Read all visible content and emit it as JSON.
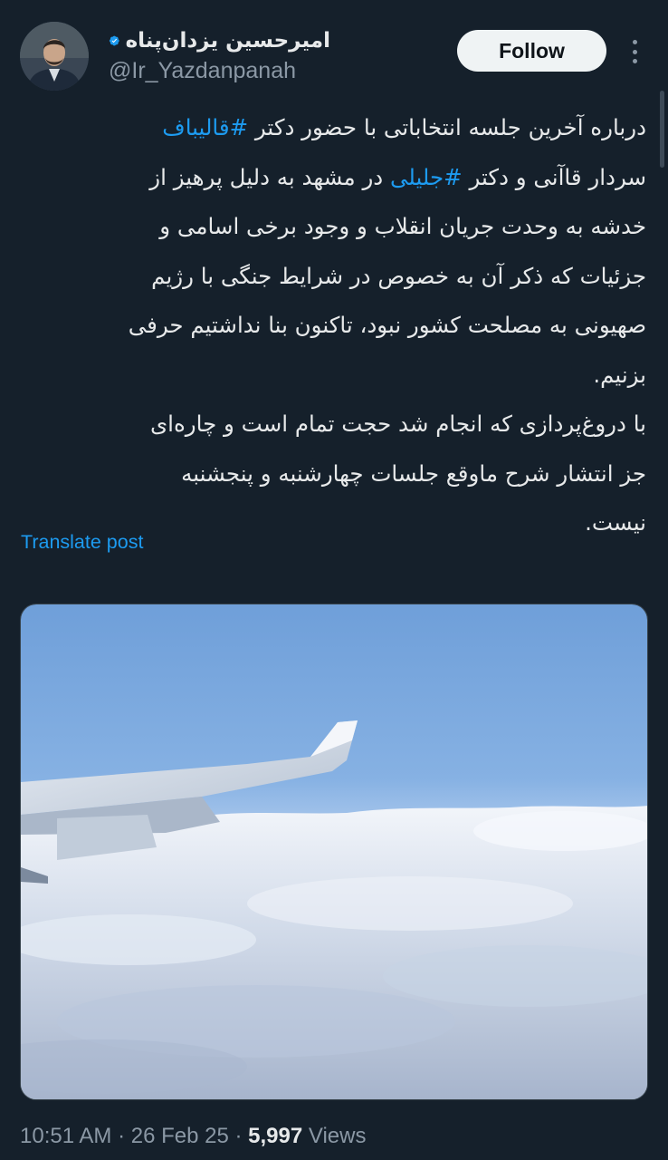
{
  "author": {
    "display_name": "امیرحسین یزدان‌پناه",
    "handle": "@Ir_Yazdanpanah",
    "verified": true,
    "verified_icon": "verified-badge-icon"
  },
  "actions": {
    "follow_label": "Follow",
    "more_icon": "more-options-icon"
  },
  "tweet": {
    "lines": [
      {
        "pre": "درباره آخرین جلسه انتخاباتی با حضور دکتر ",
        "tag": "#قالیباف",
        "post": ""
      },
      {
        "pre": "سردار قاآنی و دکتر ",
        "tag": "#جلیلی",
        "post": " در مشهد به دلیل پرهیز از"
      },
      {
        "pre": "خدشه به وحدت جریان انقلاب و وجود برخی اسامی و",
        "tag": "",
        "post": ""
      },
      {
        "pre": "جزئیات که ذکر آن به خصوص در شرایط جنگی با رژیم",
        "tag": "",
        "post": ""
      },
      {
        "pre": "صهیونی به مصلحت کشور نبود، تاکنون بنا نداشتیم حرفی",
        "tag": "",
        "post": ""
      },
      {
        "pre": "بزنیم.",
        "tag": "",
        "post": ""
      },
      {
        "pre": "با دروغ‌پردازی که انجام شد حجت تمام است و چاره‌ای",
        "tag": "",
        "post": ""
      },
      {
        "pre": "جز انتشار شرح ماوقع جلسات چهارشنبه و پنجشنبه",
        "tag": "",
        "post": ""
      },
      {
        "pre": "نیست.",
        "tag": "",
        "post": ""
      }
    ],
    "translate_label": "Translate post"
  },
  "meta": {
    "time": "10:51 AM",
    "separator": " · ",
    "date": "26 Feb 25",
    "views_count": "5,997",
    "views_label": " Views"
  },
  "colors": {
    "background": "#15202b",
    "text": "#e7e9ea",
    "secondary_text": "#8b98a5",
    "accent": "#1d9bf0"
  }
}
